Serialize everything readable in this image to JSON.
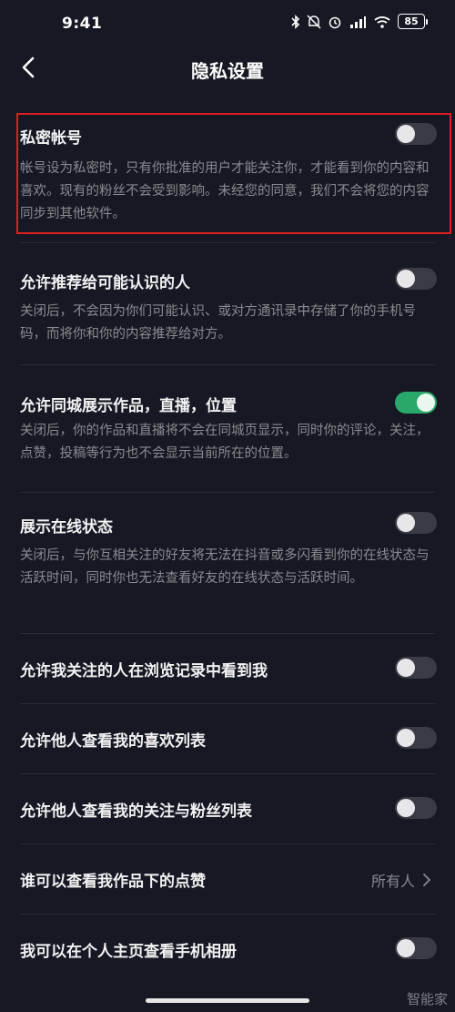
{
  "status_bar": {
    "time": "9:41",
    "battery": "85",
    "icons": [
      "bluetooth-icon",
      "mute-icon",
      "alarm-icon",
      "hd-signal-icon",
      "wifi-icon",
      "battery-icon"
    ]
  },
  "nav": {
    "title": "隐私设置",
    "back_icon": "chevron-left-icon"
  },
  "settings": [
    {
      "title": "私密帐号",
      "desc": "帐号设为私密时，只有你批准的用户才能关注你，才能看到你的内容和喜欢。现有的粉丝不会受到影响。未经您的同意，我们不会将您的内容同步到其他软件。",
      "toggle": false
    },
    {
      "title": "允许推荐给可能认识的人",
      "desc": "关闭后，不会因为你们可能认识、或对方通讯录中存储了你的手机号码，而将你和你的内容推荐给对方。",
      "toggle": false
    },
    {
      "title": "允许同城展示作品，直播，位置",
      "desc": "关闭后，你的作品和直播将不会在同城页显示，同时你的评论，关注，点赞，投稿等行为也不会显示当前所在的位置。",
      "toggle": true
    },
    {
      "title": "展示在线状态",
      "desc": "关闭后，与你互相关注的好友将无法在抖音或多闪看到你的在线状态与活跃时间，同时你也无法查看好友的在线状态与活跃时间。",
      "toggle": false
    },
    {
      "title": "允许我关注的人在浏览记录中看到我",
      "toggle": false
    },
    {
      "title": "允许他人查看我的喜欢列表",
      "toggle": false
    },
    {
      "title": "允许他人查看我的关注与粉丝列表",
      "toggle": false
    },
    {
      "title": "谁可以查看我作品下的点赞",
      "value": "所有人"
    },
    {
      "title": "我可以在个人主页查看手机相册",
      "toggle": false
    }
  ],
  "colors": {
    "background": "#161823",
    "toggle_on": "#2aa86b",
    "toggle_off": "#3a3b44",
    "highlight": "#e02020"
  },
  "watermark": "智能家"
}
